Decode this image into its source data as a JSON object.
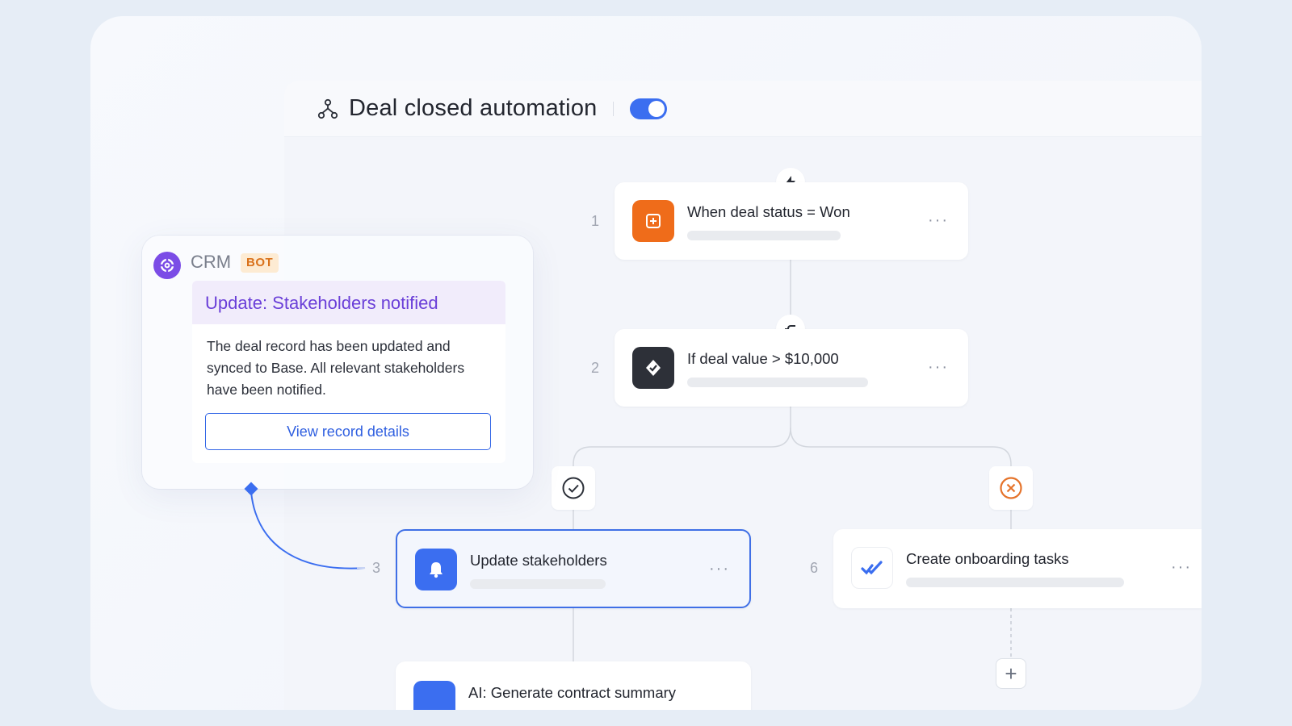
{
  "header": {
    "title": "Deal closed automation",
    "toggle_on": true
  },
  "steps": [
    {
      "num": "1",
      "label": "When deal status = Won",
      "icon": "plus-square-icon",
      "color": "#ef6c1a"
    },
    {
      "num": "2",
      "label": "If deal value > $10,000",
      "icon": "check-badge-icon",
      "color": "#2d3038"
    },
    {
      "num": "3",
      "label": "Update stakeholders",
      "icon": "bell-icon",
      "color": "#3b6ef0"
    },
    {
      "num": "6",
      "label": "Create onboarding tasks",
      "icon": "double-check-icon",
      "color": "#3b6ef0"
    },
    {
      "num": "",
      "label": "AI: Generate contract summary",
      "icon": "ai-icon",
      "color": "#3b6ef0"
    }
  ],
  "more_label": "···",
  "add_label": "+",
  "crm": {
    "name": "CRM",
    "badge": "BOT",
    "message_title": "Update: Stakeholders notified",
    "message_body": "The deal record has been updated and synced to Base. All relevant stakeholders have been notified.",
    "button_label": "View record details"
  },
  "colors": {
    "accent": "#3b6ef0",
    "trigger": "#ef6c1a",
    "crm_purple": "#7b4ce6",
    "reject": "#e5732a"
  }
}
